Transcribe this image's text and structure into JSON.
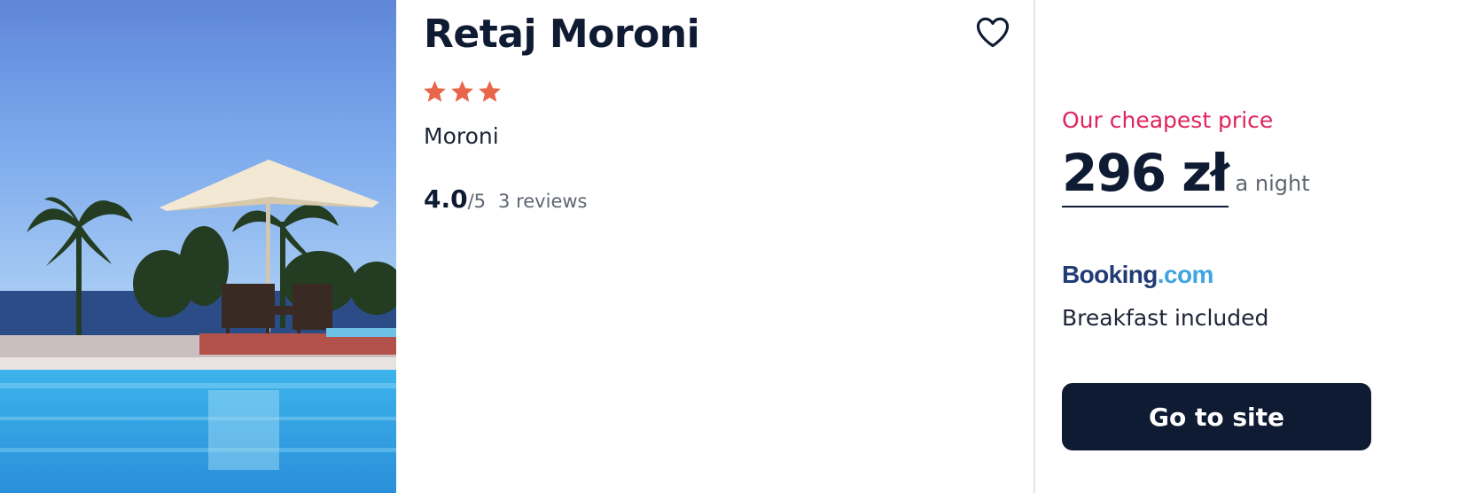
{
  "hotel": {
    "name": "Retaj Moroni",
    "star_rating": 3,
    "star_color": "#e8664a",
    "location": "Moroni",
    "score": "4.0",
    "score_scale": "/5",
    "reviews": "3 reviews",
    "favorite_icon": "heart-outline-icon"
  },
  "offer": {
    "caption": "Our cheapest price",
    "caption_color": "#e0245e",
    "price": "296 zł",
    "per": "a night",
    "provider_logo_text": "Booking.com",
    "deal_note": "Breakfast included",
    "cta_label": "Go to site",
    "cta_color": "#0f1b33"
  }
}
